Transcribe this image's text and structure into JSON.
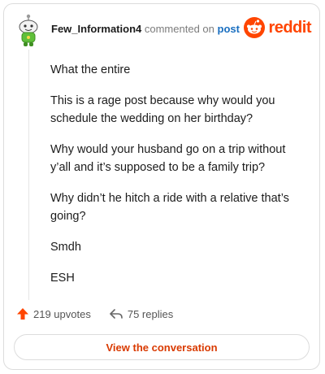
{
  "header": {
    "username": "Few_Information4",
    "action": "commented on",
    "target": "post",
    "brand": "reddit",
    "avatar_icon": "snoo-avatar-icon",
    "brand_icon": "reddit-logo-icon"
  },
  "comment": {
    "paragraphs": [
      "What the entire",
      "This is a rage post because why would you schedule the wedding on her birthday?",
      "Why would your husband go on a trip without y’all and it’s supposed to be a family trip?",
      "Why didn’t he hitch a ride with a relative that’s going?",
      "Smdh",
      "ESH"
    ]
  },
  "stats": {
    "upvotes": "219 upvotes",
    "replies": "75 replies",
    "upvote_icon": "upvote-arrow-icon",
    "reply_icon": "reply-arrow-icon"
  },
  "cta": {
    "label": "View the conversation"
  },
  "colors": {
    "accent": "#ff4500",
    "cta_text": "#d93a00",
    "link": "#1a6fc0",
    "border": "#dcdcdc"
  }
}
